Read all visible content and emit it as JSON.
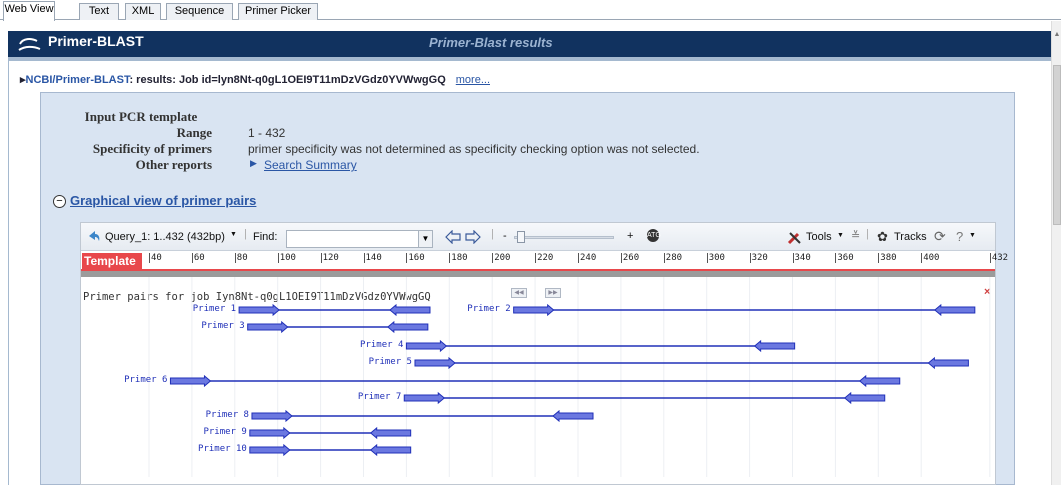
{
  "tabs": [
    "Web View",
    "Text",
    "XML",
    "Sequence",
    "Primer Picker"
  ],
  "banner": {
    "app_title": "Primer-BLAST",
    "results_title": "Primer-Blast results"
  },
  "breadcrumb": {
    "ncbi": "NCBI/",
    "primer_blast": "Primer-BLAST",
    "results": ": results: Job id=lyn8Nt-q0gL1OEI9T11mDzVGdz0YVWwgGQ",
    "more": "more..."
  },
  "info": {
    "input_label": "Input PCR template",
    "range_label": "Range",
    "range_value": "1 - 432",
    "specificity_label": "Specificity of primers",
    "specificity_value": "primer specificity was not determined as specificity checking option was not selected.",
    "other_label": "Other reports",
    "other_link": "Search Summary"
  },
  "graphical": {
    "heading": "Graphical view of primer pairs",
    "toggle": "−",
    "query": "Query_1: 1..432 (432bp)",
    "find_label": "Find:",
    "zoom_minus": "-",
    "zoom_plus": "+",
    "tools": "Tools",
    "tracks": "Tracks",
    "help": "?",
    "template_label": "Template",
    "ticks": [
      "40",
      "60",
      "80",
      "100",
      "120",
      "140",
      "160",
      "180",
      "200",
      "220",
      "240",
      "260",
      "280",
      "300",
      "320",
      "340",
      "360",
      "380",
      "400",
      "432"
    ],
    "track_title": "Primer pairs for job Iyn8Nt-q0gL1OEI9T11mDzVGdz0YVWwgGQ",
    "close": "×"
  },
  "primer_pairs": [
    {
      "name": "Primer 1",
      "start": 82,
      "end": 171
    },
    {
      "name": "Primer 2",
      "start": 210,
      "end": 425
    },
    {
      "name": "Primer 3",
      "start": 86,
      "end": 170
    },
    {
      "name": "Primer 4",
      "start": 160,
      "end": 341
    },
    {
      "name": "Primer 5",
      "start": 164,
      "end": 422
    },
    {
      "name": "Primer 6",
      "start": 50,
      "end": 390
    },
    {
      "name": "Primer 7",
      "start": 159,
      "end": 383
    },
    {
      "name": "Primer 8",
      "start": 88,
      "end": 247
    },
    {
      "name": "Primer 9",
      "start": 87,
      "end": 162
    },
    {
      "name": "Primer 10",
      "start": 87,
      "end": 162
    }
  ],
  "colors": {
    "banner": "#11325f",
    "panel": "#d9e4f2",
    "link": "#2a56a5",
    "template_red": "#e8474b",
    "primer_blue": "#2030b8",
    "primer_fill": "#6b78e0"
  }
}
